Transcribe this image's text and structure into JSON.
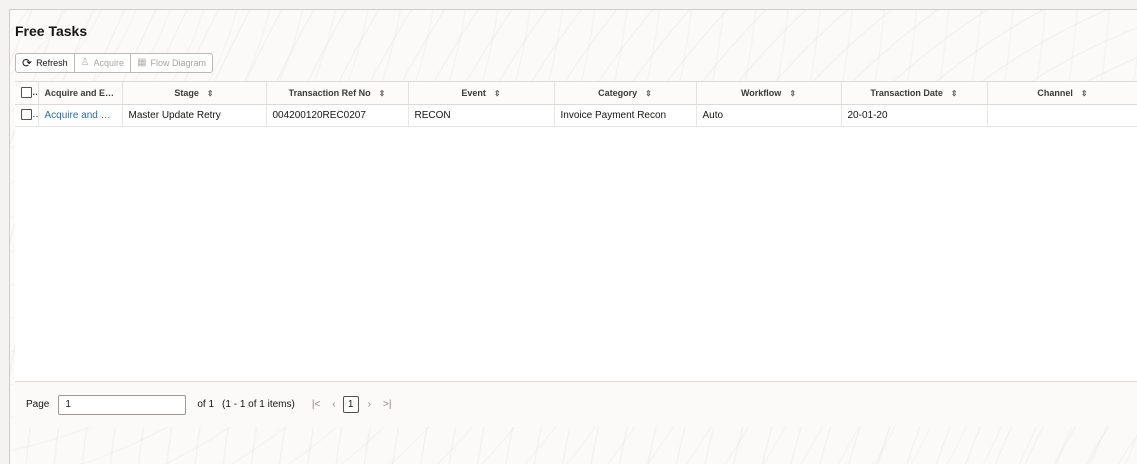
{
  "panel": {
    "title": "Free Tasks"
  },
  "toolbar": {
    "refresh_label": "Refresh",
    "acquire_label": "Acquire",
    "flow_diagram_label": "Flow Diagram"
  },
  "table": {
    "columns": [
      "Acquire and Edit",
      "Stage",
      "Transaction Ref No",
      "Event",
      "Category",
      "Workflow",
      "Transaction Date",
      "Channel"
    ],
    "rows": [
      {
        "acquire_and_edit": "Acquire and Edit",
        "stage": "Master Update Retry",
        "transaction_ref_no": "004200120REC0207",
        "event": "RECON",
        "category": "Invoice Payment Recon",
        "workflow": "Auto",
        "transaction_date": "20-01-20",
        "channel": ""
      }
    ]
  },
  "pager": {
    "page_label": "Page",
    "page_value": "1",
    "of_text": "of 1",
    "items_text": "(1 - 1 of 1 items)",
    "current_page": "1",
    "first_glyph": "|<",
    "prev_glyph": "‹",
    "next_glyph": "›",
    "last_glyph": ">|"
  }
}
